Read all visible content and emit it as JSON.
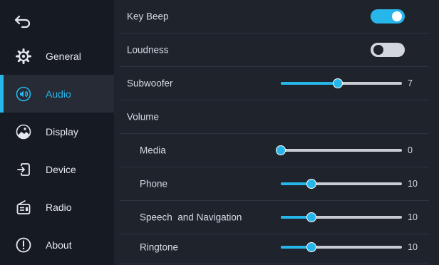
{
  "colors": {
    "accent": "#27b6ea",
    "sidebar_bg": "#161a22",
    "content_bg": "#1f232c"
  },
  "sidebar": {
    "back_icon": "back-arrow-icon",
    "items": [
      {
        "label": "General",
        "icon": "gear-icon",
        "active": false
      },
      {
        "label": "Audio",
        "icon": "speaker-icon",
        "active": true
      },
      {
        "label": "Display",
        "icon": "display-brightness-icon",
        "active": false
      },
      {
        "label": "Device",
        "icon": "device-input-icon",
        "active": false
      },
      {
        "label": "Radio",
        "icon": "radio-icon",
        "active": false
      },
      {
        "label": "About",
        "icon": "info-icon",
        "active": false
      }
    ]
  },
  "settings": {
    "key_beep": {
      "label": "Key Beep",
      "on": true
    },
    "loudness": {
      "label": "Loudness",
      "on": false
    },
    "subwoofer": {
      "label": "Subwoofer",
      "value": "7",
      "fraction": 0.47
    },
    "volume_header": {
      "label": "Volume"
    },
    "media": {
      "label": "Media",
      "value": "0",
      "fraction": 0.0
    },
    "phone": {
      "label": "Phone",
      "value": "10",
      "fraction": 0.25
    },
    "speech_navigation": {
      "label": "Speech  and Navigation",
      "value": "10",
      "fraction": 0.25
    },
    "ringtone": {
      "label": "Ringtone",
      "value": "10",
      "fraction": 0.25
    }
  }
}
